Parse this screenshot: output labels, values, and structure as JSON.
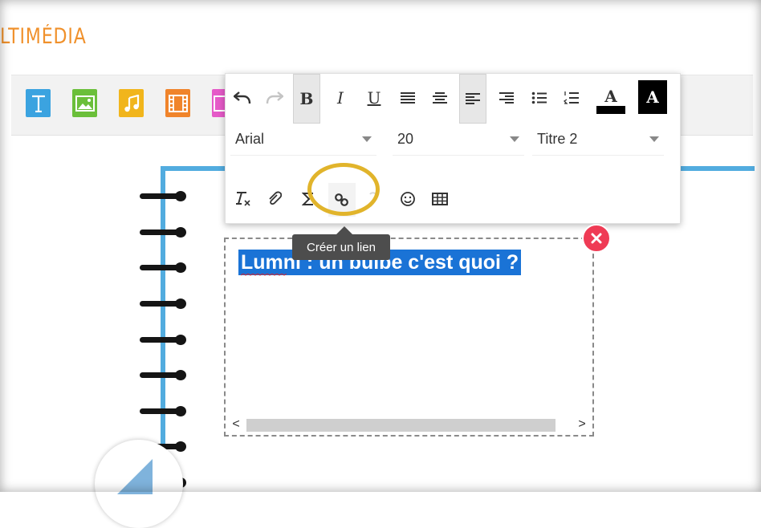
{
  "app": {
    "title": "LTIMÉDIA"
  },
  "insert_toolbar": [
    {
      "name": "text",
      "icon": "text-icon",
      "color": "#3ba3e0"
    },
    {
      "name": "image",
      "icon": "image-icon",
      "color": "#6bbf3a"
    },
    {
      "name": "audio",
      "icon": "music-icon",
      "color": "#f1b51c"
    },
    {
      "name": "video",
      "icon": "film-icon",
      "color": "#f0842b"
    },
    {
      "name": "other",
      "icon": "app-icon",
      "color": "#e55ac8"
    }
  ],
  "format_toolbar": {
    "font": {
      "value": "Arial"
    },
    "size": {
      "value": "20"
    },
    "style": {
      "value": "Titre 2"
    },
    "bold_label": "B",
    "italic_label": "I",
    "underline_label": "U",
    "text_color_label": "A",
    "bg_color_label": "A",
    "active_buttons": [
      "bold",
      "align-left"
    ],
    "highlight_color": "#e1b42b"
  },
  "tooltip": {
    "text": "Créer un lien"
  },
  "editor": {
    "selected_text": "Lumni : un bulbe c'est quoi ?",
    "selection_color": "#1a73d6",
    "delete_color": "#ef3b55"
  },
  "scroll": {
    "left": "<",
    "right": ">"
  }
}
